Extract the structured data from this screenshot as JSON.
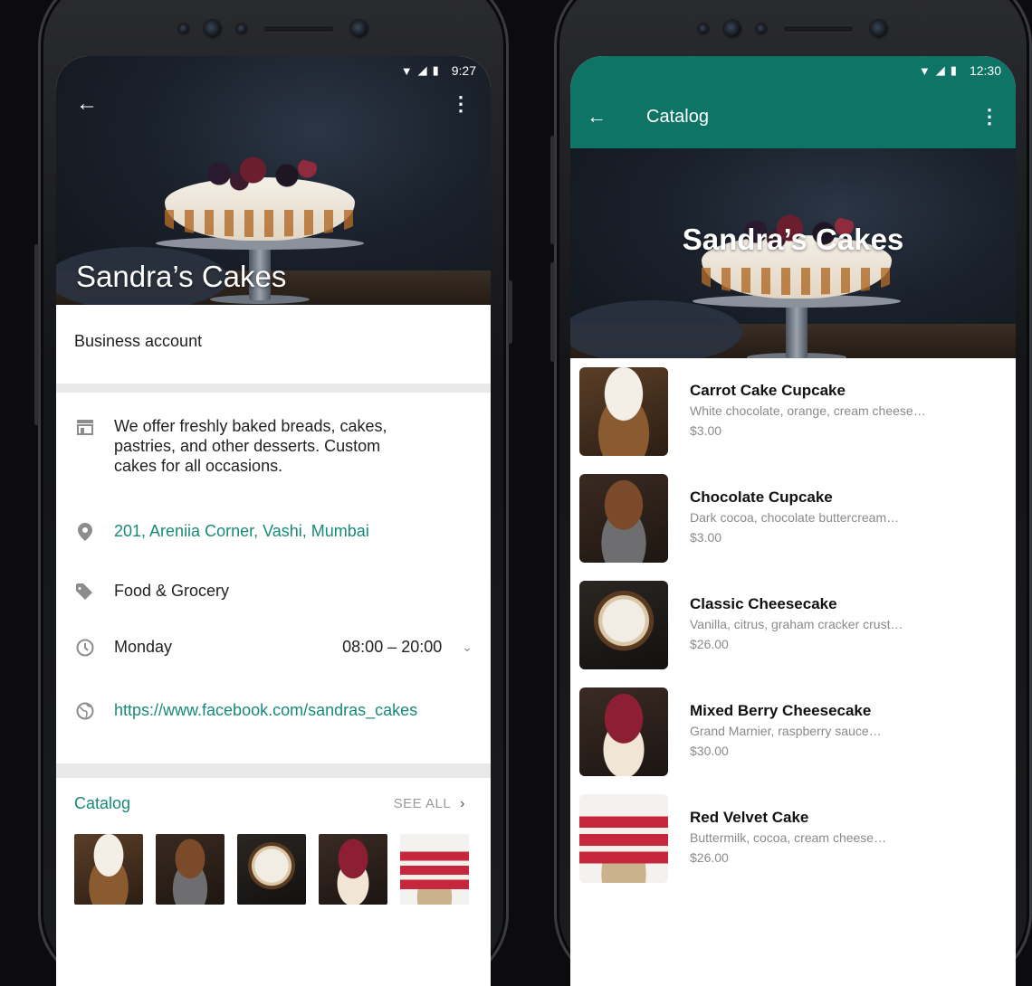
{
  "left": {
    "status": {
      "time": "9:27",
      "wifi_icon": "wifi-icon",
      "signal_icon": "signal-icon",
      "battery_icon": "battery-icon"
    },
    "business_name": "Sandra’s Cakes",
    "account_type": "Business account",
    "description": "We offer freshly baked breads, cakes, pastries, and other desserts. Custom cakes for all occasions.",
    "address": "201, Areniia Corner, Vashi, Mumbai",
    "category": "Food & Grocery",
    "hours": {
      "day": "Monday",
      "time": "08:00 – 20:00"
    },
    "website": "https://www.facebook.com/sandras_cakes",
    "catalog": {
      "title": "Catalog",
      "see_all": "SEE ALL"
    }
  },
  "right": {
    "status": {
      "time": "12:30"
    },
    "title": "Catalog",
    "business_name": "Sandra’s Cakes",
    "products": [
      {
        "name": "Carrot Cake Cupcake",
        "description": "White chocolate, orange, cream cheese…",
        "price": "$3.00"
      },
      {
        "name": "Chocolate Cupcake",
        "description": "Dark cocoa, chocolate buttercream…",
        "price": "$3.00"
      },
      {
        "name": "Classic Cheesecake",
        "description": "Vanilla, citrus, graham cracker crust…",
        "price": "$26.00"
      },
      {
        "name": "Mixed Berry Cheesecake",
        "description": "Grand Marnier, raspberry sauce…",
        "price": "$30.00"
      },
      {
        "name": "Red Velvet Cake",
        "description": "Buttermilk, cocoa, cream cheese…",
        "price": "$26.00"
      }
    ]
  },
  "colors": {
    "teal": "#168a7a",
    "header_green": "#0e7465"
  }
}
